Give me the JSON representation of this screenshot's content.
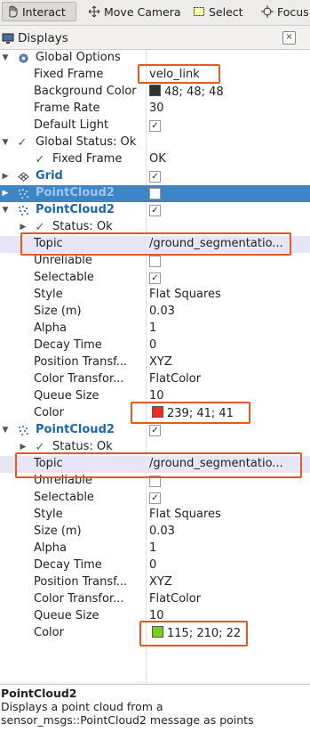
{
  "toolbar": {
    "interact": "Interact",
    "move_camera": "Move Camera",
    "select": "Select",
    "focus": "Focus"
  },
  "panel": {
    "title": "Displays",
    "close": "×"
  },
  "tree": {
    "global_options": "Global Options",
    "fixed_frame": {
      "label": "Fixed Frame",
      "value": "velo_link"
    },
    "background_color": {
      "label": "Background Color",
      "value": "48; 48; 48",
      "swatch": "#303030"
    },
    "frame_rate": {
      "label": "Frame Rate",
      "value": "30"
    },
    "default_light": {
      "label": "Default Light",
      "checked": "✓"
    },
    "global_status": "Global Status: Ok",
    "gs_fixed_frame": {
      "label": "Fixed Frame",
      "value": "OK"
    },
    "grid": {
      "label": "Grid",
      "checked": "✓"
    },
    "pc_selected": {
      "label": "PointCloud2",
      "checked": ""
    },
    "pc1": {
      "label": "PointCloud2",
      "checked": "✓",
      "status": "Status: Ok",
      "topic": {
        "label": "Topic",
        "value": "/ground_segmentatio..."
      },
      "unreliable": {
        "label": "Unreliable",
        "checked": ""
      },
      "selectable": {
        "label": "Selectable",
        "checked": "✓"
      },
      "style": {
        "label": "Style",
        "value": "Flat Squares"
      },
      "size": {
        "label": "Size (m)",
        "value": "0.03"
      },
      "alpha": {
        "label": "Alpha",
        "value": "1"
      },
      "decay": {
        "label": "Decay Time",
        "value": "0"
      },
      "pos_transf": {
        "label": "Position Transf...",
        "value": "XYZ"
      },
      "color_transf": {
        "label": "Color Transfor...",
        "value": "FlatColor"
      },
      "queue": {
        "label": "Queue Size",
        "value": "10"
      },
      "color": {
        "label": "Color",
        "value": "239; 41; 41",
        "swatch": "#ef2929"
      }
    },
    "pc2": {
      "label": "PointCloud2",
      "checked": "✓",
      "status": "Status: Ok",
      "topic": {
        "label": "Topic",
        "value": "/ground_segmentatio..."
      },
      "unreliable": {
        "label": "Unreliable",
        "checked": ""
      },
      "selectable": {
        "label": "Selectable",
        "checked": "✓"
      },
      "style": {
        "label": "Style",
        "value": "Flat Squares"
      },
      "size": {
        "label": "Size (m)",
        "value": "0.03"
      },
      "alpha": {
        "label": "Alpha",
        "value": "1"
      },
      "decay": {
        "label": "Decay Time",
        "value": "0"
      },
      "pos_transf": {
        "label": "Position Transf...",
        "value": "XYZ"
      },
      "color_transf": {
        "label": "Color Transfor...",
        "value": "FlatColor"
      },
      "queue": {
        "label": "Queue Size",
        "value": "10"
      },
      "color": {
        "label": "Color",
        "value": "115; 210; 22",
        "swatch": "#73d216"
      }
    }
  },
  "description": {
    "title": "PointCloud2",
    "text": "Displays a point cloud from a sensor_msgs::PointCloud2 message as points"
  }
}
